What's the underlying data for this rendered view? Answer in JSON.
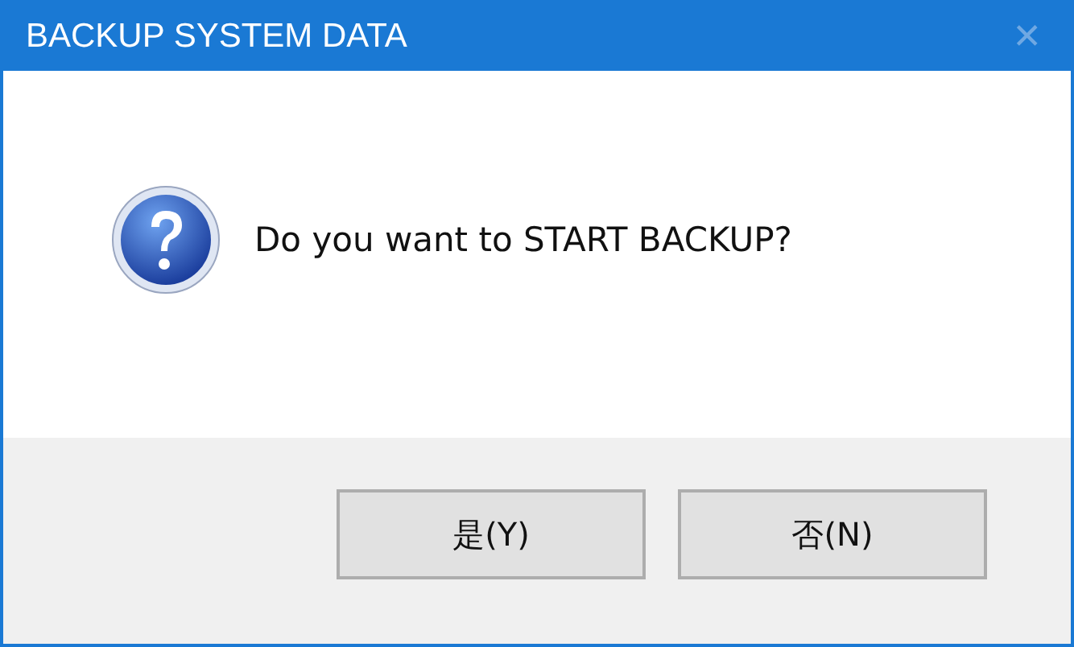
{
  "window": {
    "title": "BACKUP SYSTEM DATA",
    "close": "✕"
  },
  "message": "Do you want to START BACKUP?",
  "buttons": [
    {
      "label": "是(Y)"
    },
    {
      "label": "否(N)"
    }
  ]
}
